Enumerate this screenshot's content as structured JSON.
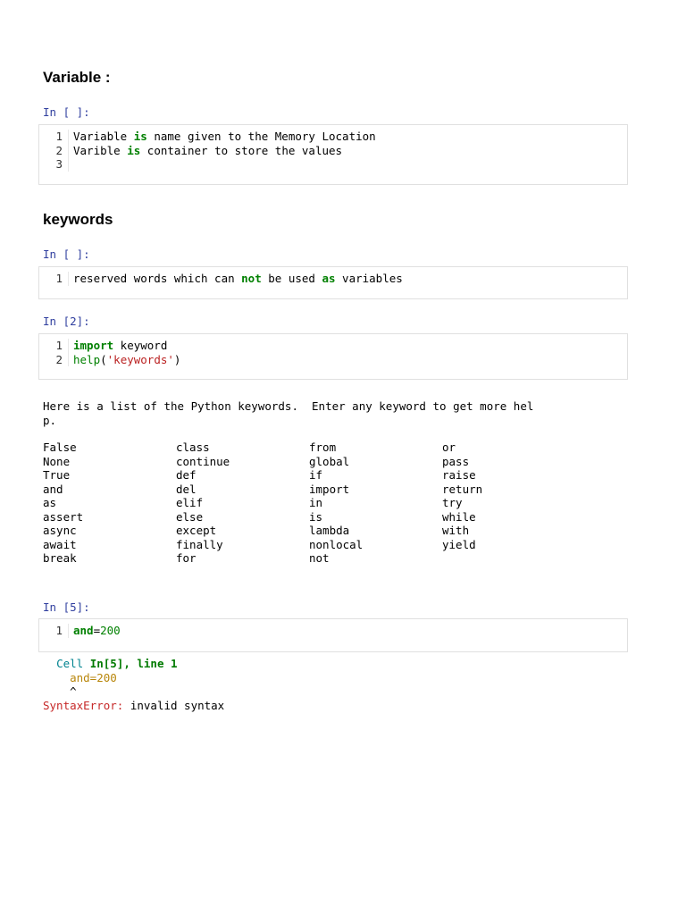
{
  "headings": {
    "variable": "Variable :",
    "keywords": "keywords"
  },
  "cells": {
    "cell1": {
      "prompt": "In [ ]:",
      "lines": [
        {
          "n": "1",
          "parts": [
            [
              "",
              "Variable "
            ],
            [
              "kw",
              "is"
            ],
            [
              "",
              " name given to the Memory Location"
            ]
          ]
        },
        {
          "n": "2",
          "parts": [
            [
              "",
              "Varible "
            ],
            [
              "kw",
              "is"
            ],
            [
              "",
              " container to store the values"
            ]
          ]
        },
        {
          "n": "3",
          "parts": [
            [
              "",
              ""
            ]
          ]
        }
      ]
    },
    "cell2": {
      "prompt": "In [ ]:",
      "lines": [
        {
          "n": "1",
          "parts": [
            [
              "",
              "reserved words which can "
            ],
            [
              "kw",
              "not"
            ],
            [
              "",
              " be used "
            ],
            [
              "kw",
              "as"
            ],
            [
              "",
              " variables"
            ]
          ]
        }
      ]
    },
    "cell3": {
      "prompt": "In [2]:",
      "lines": [
        {
          "n": "1",
          "parts": [
            [
              "kw",
              "import"
            ],
            [
              "",
              " keyword"
            ]
          ]
        },
        {
          "n": "2",
          "parts": [
            [
              "kwn",
              "help"
            ],
            [
              "",
              "("
            ],
            [
              "str",
              "'keywords'"
            ],
            [
              "",
              ")"
            ]
          ]
        }
      ]
    },
    "cell4": {
      "prompt": "In [5]:",
      "lines": [
        {
          "n": "1",
          "parts": [
            [
              "kw",
              "and"
            ],
            [
              "",
              "="
            ],
            [
              "num",
              "200"
            ]
          ]
        }
      ]
    }
  },
  "help_output": {
    "intro_line1": "Here is a list of the Python keywords.  Enter any keyword to get more hel",
    "intro_line2": "p.",
    "keywords": [
      [
        "False",
        "class",
        "from",
        "or"
      ],
      [
        "None",
        "continue",
        "global",
        "pass"
      ],
      [
        "True",
        "def",
        "if",
        "raise"
      ],
      [
        "and",
        "del",
        "import",
        "return"
      ],
      [
        "as",
        "elif",
        "in",
        "try"
      ],
      [
        "assert",
        "else",
        "is",
        "while"
      ],
      [
        "async",
        "except",
        "lambda",
        "with"
      ],
      [
        "await",
        "finally",
        "nonlocal",
        "yield"
      ],
      [
        "break",
        "for",
        "not",
        ""
      ]
    ]
  },
  "error_output": {
    "cell_label": "Cell",
    "cell_location": "In[5], line 1",
    "code": "and=200",
    "caret": "^",
    "error_name": "SyntaxError:",
    "error_message": " invalid syntax"
  }
}
